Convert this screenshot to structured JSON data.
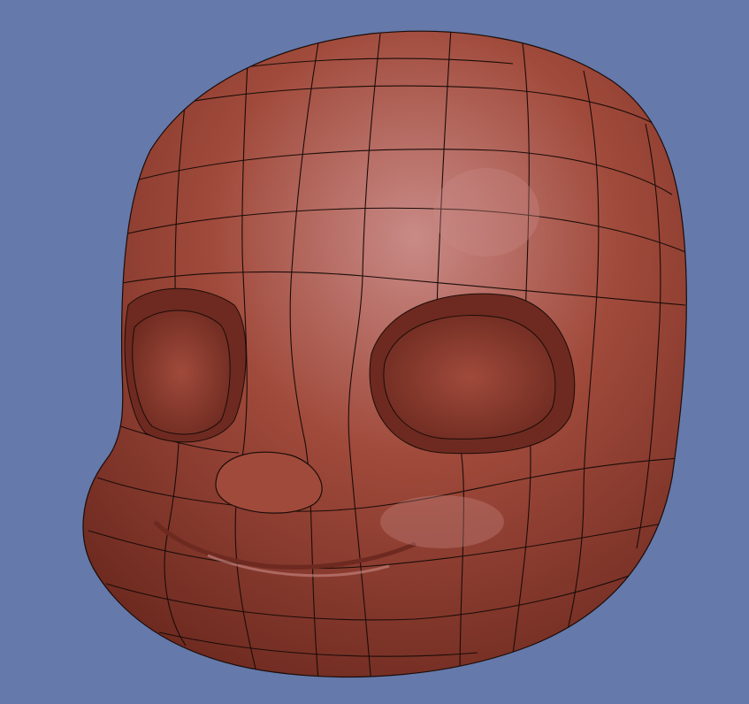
{
  "viewport": {
    "background_color": "#6579aa",
    "mesh_color": "#a04a3b",
    "mesh_shadow_color": "#6e2a20",
    "mesh_highlight_color": "#c98a86",
    "wireframe_color": "#1a0c08"
  },
  "model": {
    "icon": "cartoon-head-mesh",
    "features": [
      "cranium",
      "left-eye-socket",
      "right-eye-socket",
      "nose",
      "mouth",
      "cheeks"
    ]
  }
}
